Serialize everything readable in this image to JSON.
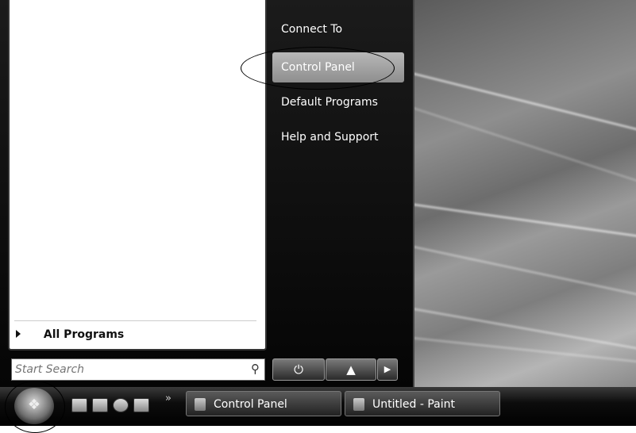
{
  "right_menu": {
    "items": [
      "Connect To",
      "Control Panel",
      "Default Programs",
      "Help and Support"
    ]
  },
  "left_menu": {
    "all_programs": "All Programs"
  },
  "search": {
    "placeholder": "Start Search"
  },
  "power": {
    "power_icon": "power-icon",
    "lock_icon": "lock-icon",
    "arrow_icon": "arrow-right-icon"
  },
  "taskbar": {
    "overflow": "»",
    "tasks": [
      "Control Panel",
      "Untitled - Paint"
    ]
  },
  "colors": {
    "menu_bg": "#0a0a0a",
    "highlight": "#a5a5a5"
  }
}
